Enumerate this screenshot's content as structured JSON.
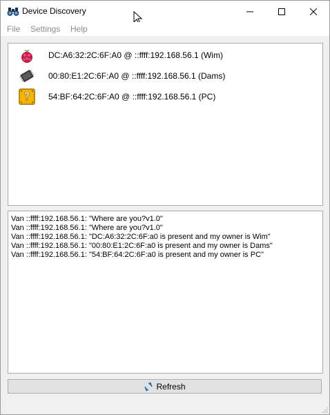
{
  "window": {
    "title": "Device Discovery"
  },
  "menu": {
    "items": [
      {
        "label": "File"
      },
      {
        "label": "Settings"
      },
      {
        "label": "Help"
      }
    ]
  },
  "devices": [
    {
      "label": "DC:A6:32:2C:6F:A0 @ ::ffff:192.168.56.1 (Wim)",
      "icon": "raspberry-pi-icon"
    },
    {
      "label": "00:80:E1:2C:6F:A0 @ ::ffff:192.168.56.1 (Dams)",
      "icon": "chip-icon"
    },
    {
      "label": "54:BF:64:2C:6F:A0 @ ::ffff:192.168.56.1 (PC)",
      "icon": "question-block-icon"
    }
  ],
  "log": [
    "Van ::ffff:192.168.56.1: \"Where are you?v1.0\"",
    "Van ::ffff:192.168.56.1: \"Where are you?v1.0\"",
    "Van ::ffff:192.168.56.1: \"DC:A6:32:2C:6F:a0 is present and my owner is Wim\"",
    "Van ::ffff:192.168.56.1: \"00:80:E1:2C:6F:a0 is present and my owner is Dams\"",
    "Van ::ffff:192.168.56.1: \"54:BF:64:2C:6F:a0 is present and my owner is PC\""
  ],
  "refresh": {
    "label": "Refresh"
  },
  "colors": {
    "title_bar": "#ffffff",
    "window_bg": "#f0f0f0",
    "menu_disabled_text": "#8c8c8c",
    "button_bg": "#e1e1e1",
    "refresh_icon_blue": "#1f6fb5"
  }
}
